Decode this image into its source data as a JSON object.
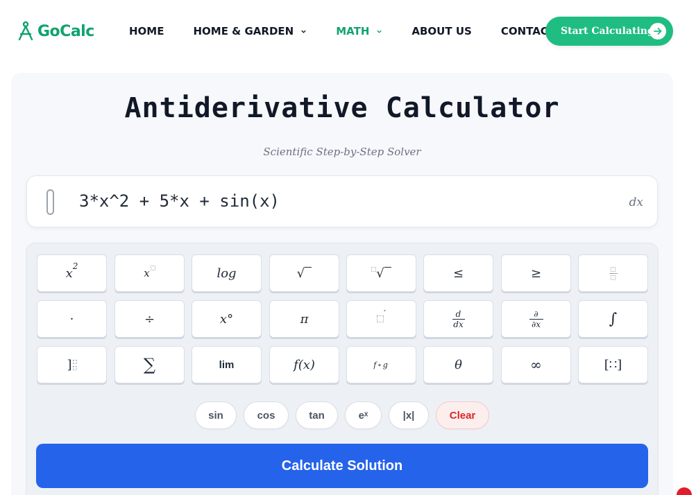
{
  "brand": {
    "name": "GoCalc",
    "color": "#10a36e"
  },
  "nav": {
    "home": "HOME",
    "garden": "HOME & GARDEN",
    "math": "MATH",
    "about": "ABOUT US",
    "contact": "CONTACT US"
  },
  "cta": {
    "label": "Start Calculating"
  },
  "page": {
    "title": "Antiderivative Calculator",
    "subtitle": "Scientific Step-by-Step Solver"
  },
  "input": {
    "expression": "3*x^2 + 5*x + sin(x)",
    "suffix": "dx"
  },
  "keys": {
    "square": "x",
    "square_exp": "2",
    "power": "x",
    "log": "log",
    "sqrt": "√",
    "nthroot": "√",
    "le": "≤",
    "ge": "≥",
    "dot": "·",
    "div": "÷",
    "deg": "x°",
    "pi": "π",
    "prime": "′",
    "d_num": "d",
    "d_den": "dx",
    "p_num": "∂",
    "p_den": "∂x",
    "integral": "∫",
    "sum": "∑",
    "lim": "lim",
    "fx": "f(x)",
    "compose": "f∘g",
    "theta": "θ",
    "infinity": "∞",
    "matrix": "[∷]"
  },
  "functions": [
    "sin",
    "cos",
    "tan",
    "eˣ",
    "|x|"
  ],
  "clear_label": "Clear",
  "calculate_label": "Calculate Solution",
  "colors": {
    "accent": "#10a36e",
    "cta": "#1fbd82",
    "primary": "#2563eb",
    "danger": "#dc2626"
  }
}
